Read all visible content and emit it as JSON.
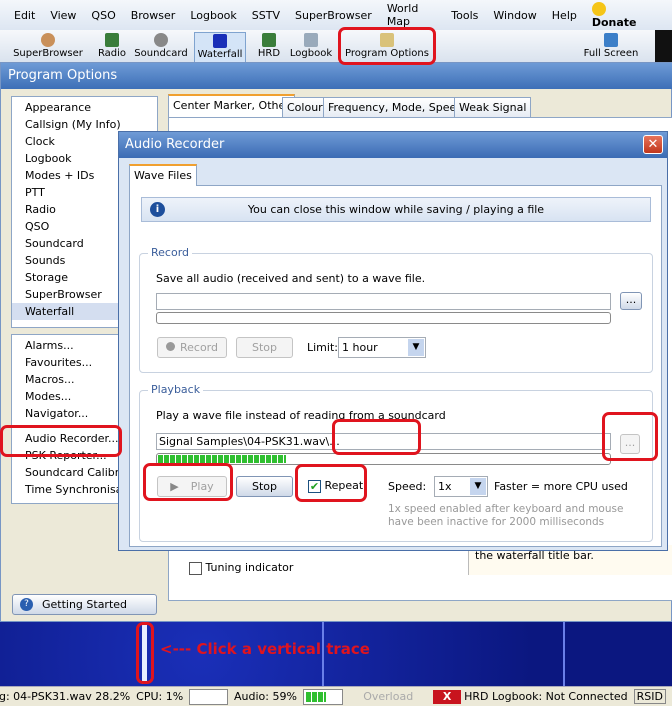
{
  "menu": [
    "Edit",
    "View",
    "QSO",
    "Browser",
    "Logbook",
    "SSTV",
    "SuperBrowser",
    "World Map",
    "Tools",
    "Window",
    "Help"
  ],
  "donate": "Donate",
  "toolbar": {
    "superbrowser": "SuperBrowser",
    "radio": "Radio",
    "soundcard": "Soundcard",
    "waterfall": "Waterfall",
    "hrd": "HRD",
    "logbook": "Logbook",
    "program_options": "Program Options",
    "full_screen": "Full Screen"
  },
  "program_options": {
    "title": "Program Options",
    "list1": [
      "Appearance",
      "Callsign (My Info)",
      "Clock",
      "Logbook",
      "Modes + IDs",
      "PTT",
      "Radio",
      "QSO",
      "Soundcard",
      "Sounds",
      "Storage",
      "SuperBrowser",
      "Waterfall"
    ],
    "list2": [
      "Alarms...",
      "Favourites...",
      "Macros...",
      "Modes...",
      "Navigator...",
      "Audio Recorder...",
      "PSK Reporter...",
      "Soundcard Calibration...",
      "Time Synchronisation..."
    ],
    "tabs": [
      "Center Marker, Other",
      "Colour",
      "Frequency, Mode, Speed",
      "Weak Signal"
    ],
    "tuning_indicator": "Tuning indicator",
    "hint_text": "the waterfall title bar.",
    "getting_started": "Getting Started"
  },
  "audio_recorder": {
    "title": "Audio Recorder",
    "tab": "Wave Files",
    "info": "You can close this window while saving / playing a file",
    "record": {
      "group": "Record",
      "desc": "Save all audio (received and sent) to a wave file.",
      "file": "",
      "browse": "...",
      "record_btn": "Record",
      "stop_btn": "Stop",
      "limit_label": "Limit:",
      "limit_value": "1 hour",
      "progress": 0
    },
    "playback": {
      "group": "Playback",
      "desc": "Play a wave file instead of reading from a soundcard",
      "file": "...\\Signal Samples\\04-PSK31.wav",
      "browse": "...",
      "progress": 28.2,
      "play_btn": "Play",
      "stop_btn": "Stop",
      "repeat_label": "Repeat",
      "repeat_checked": true,
      "speed_label": "Speed:",
      "speed_value": "1x",
      "speed_note": "Faster = more CPU used",
      "speed_help": "1x speed enabled after keyboard and mouse have been inactive for 2000 milliseconds"
    }
  },
  "annotation": "<--- Click a vertical trace",
  "status": {
    "playing": "g: 04-PSK31.wav  28.2%",
    "cpu": "CPU: 1%",
    "audio": "Audio: 59%",
    "audio_level": 59,
    "overload": "Overload",
    "hrd_logbook": "HRD Logbook: Not Connected",
    "rsid": "RSID"
  },
  "colors": {
    "highlight_red": "#e0141e",
    "title_blue": "#3d6fb7",
    "progress_green": "#2fbf2f"
  }
}
